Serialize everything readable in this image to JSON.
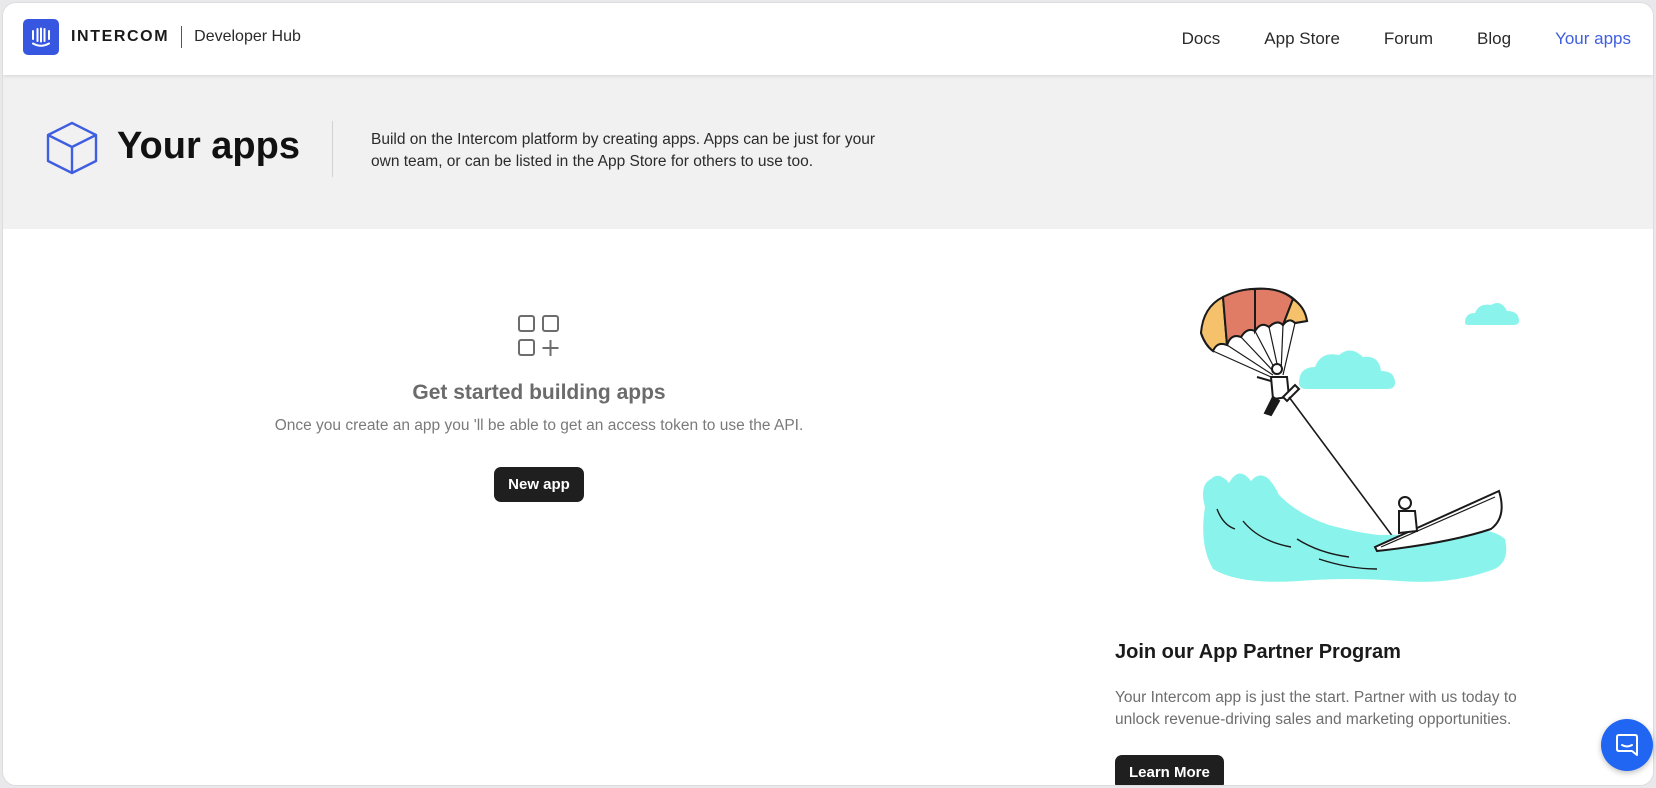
{
  "header": {
    "brand_name": "INTERCOM",
    "brand_sub": "Developer Hub",
    "nav": [
      {
        "label": "Docs"
      },
      {
        "label": "App Store"
      },
      {
        "label": "Forum"
      },
      {
        "label": "Blog"
      },
      {
        "label": "Your apps",
        "active": true
      }
    ]
  },
  "hero": {
    "icon": "cube-icon",
    "title": "Your apps",
    "description": "Build on the Intercom platform by creating apps. Apps can be just for your own team, or can be listed in the App Store for others to use too."
  },
  "empty_state": {
    "icon": "apps-grid-plus-icon",
    "title": "Get started building apps",
    "description": "Once you create an app you 'll be able to get an access token to use the API.",
    "button_label": "New app"
  },
  "promo": {
    "illustration": "parasailing-illustration",
    "title": "Join our App Partner Program",
    "description": "Your Intercom app is just the start. Partner with us today to unlock revenue-driving sales and marketing opportunities.",
    "button_label": "Learn More"
  },
  "chat": {
    "icon": "chat-bubble-icon"
  },
  "colors": {
    "brand_blue": "#3757e0",
    "active_nav": "#3f5ee0",
    "dark_button": "#1f1f1f",
    "hero_bg": "#f1f1f1",
    "cloud_cyan": "#8af4ec",
    "chat_blue": "#2166f2"
  }
}
